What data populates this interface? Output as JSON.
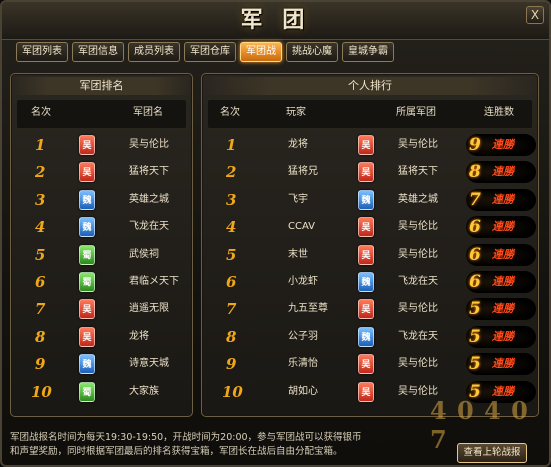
{
  "window": {
    "title": "军 团",
    "close_label": "X"
  },
  "tabs": [
    "军团列表",
    "军团信息",
    "成员列表",
    "军团仓库",
    "军团战",
    "挑战心魔",
    "皇城争霸"
  ],
  "active_tab": "军团战",
  "legion_ranking": {
    "title": "军团排名",
    "headers": {
      "rank": "名次",
      "name": "军团名"
    },
    "rows": [
      {
        "rank": "1",
        "faction": "吴",
        "name": "吴与伦比"
      },
      {
        "rank": "2",
        "faction": "吴",
        "name": "猛将天下"
      },
      {
        "rank": "3",
        "faction": "魏",
        "name": "英雄之城"
      },
      {
        "rank": "4",
        "faction": "魏",
        "name": "飞龙在天"
      },
      {
        "rank": "5",
        "faction": "蜀",
        "name": "武侯祠"
      },
      {
        "rank": "6",
        "faction": "蜀",
        "name": "君临メ天下"
      },
      {
        "rank": "7",
        "faction": "吴",
        "name": "逍遥无限"
      },
      {
        "rank": "8",
        "faction": "吴",
        "name": "龙将"
      },
      {
        "rank": "9",
        "faction": "魏",
        "name": "诗意天城"
      },
      {
        "rank": "10",
        "faction": "蜀",
        "name": "大家族"
      }
    ]
  },
  "personal_ranking": {
    "title": "个人排行",
    "headers": {
      "rank": "名次",
      "player": "玩家",
      "legion": "所属军团",
      "streak": "连胜数"
    },
    "rows": [
      {
        "rank": "1",
        "player": "龙将",
        "faction": "吴",
        "legion": "吴与伦比",
        "streak": "9",
        "streak_label": "連勝"
      },
      {
        "rank": "2",
        "player": "猛将兄",
        "faction": "吴",
        "legion": "猛将天下",
        "streak": "8",
        "streak_label": "連勝"
      },
      {
        "rank": "3",
        "player": "飞宇",
        "faction": "魏",
        "legion": "英雄之城",
        "streak": "7",
        "streak_label": "連勝"
      },
      {
        "rank": "4",
        "player": "CCAV",
        "faction": "吴",
        "legion": "吴与伦比",
        "streak": "6",
        "streak_label": "連勝"
      },
      {
        "rank": "5",
        "player": "末世",
        "faction": "吴",
        "legion": "吴与伦比",
        "streak": "6",
        "streak_label": "連勝"
      },
      {
        "rank": "6",
        "player": "小龙虾",
        "faction": "魏",
        "legion": "飞龙在天",
        "streak": "6",
        "streak_label": "連勝"
      },
      {
        "rank": "7",
        "player": "九五至尊",
        "faction": "吴",
        "legion": "吴与伦比",
        "streak": "5",
        "streak_label": "連勝"
      },
      {
        "rank": "8",
        "player": "公子羽",
        "faction": "魏",
        "legion": "飞龙在天",
        "streak": "5",
        "streak_label": "連勝"
      },
      {
        "rank": "9",
        "player": "乐清怡",
        "faction": "吴",
        "legion": "吴与伦比",
        "streak": "5",
        "streak_label": "連勝"
      },
      {
        "rank": "10",
        "player": "胡如心",
        "faction": "吴",
        "legion": "吴与伦比",
        "streak": "5",
        "streak_label": "連勝"
      }
    ]
  },
  "notice": {
    "line1": "军团战报名时间为每天19:30-19:50，开战时间为20:00，参与军团战可以获得银币",
    "line2": "和声望奖励，同时根据军团最后的排名获得宝箱，军团长在战后自由分配宝箱。"
  },
  "button_label": "查看上轮战报",
  "watermark": "4 0 4 0 7",
  "colors": {
    "accent": "#f0a818",
    "active_tab": "#e8860e",
    "streak_label": "#ff4a1a",
    "wu": "#c0281a",
    "wei": "#1c5fb8",
    "shu": "#2c8a1c"
  }
}
